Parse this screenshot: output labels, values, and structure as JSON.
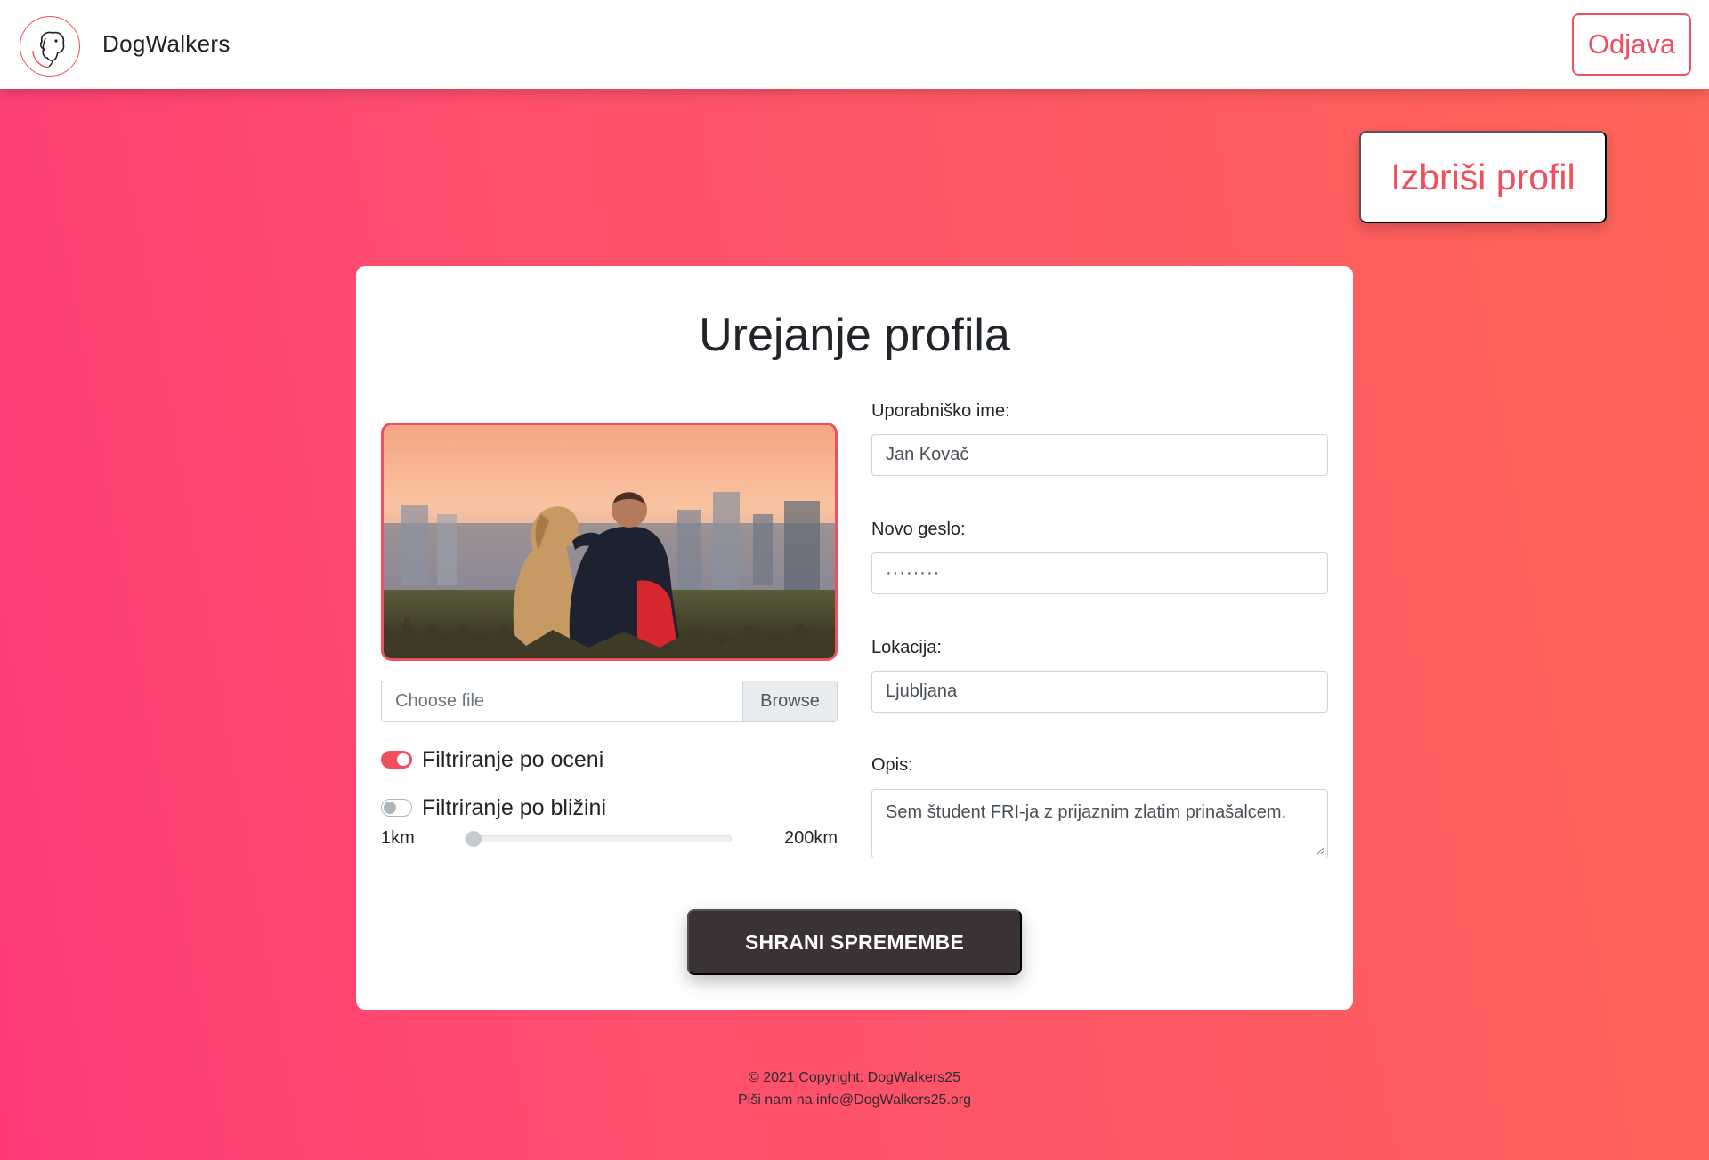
{
  "navbar": {
    "brand": "DogWalkers",
    "logout_label": "Odjava"
  },
  "delete_profile_label": "Izbriši profil",
  "form": {
    "title": "Urejanje profila",
    "file_input": {
      "placeholder": "Choose file",
      "browse_label": "Browse"
    },
    "toggles": [
      {
        "label": "Filtriranje po oceni",
        "on": true
      },
      {
        "label": "Filtriranje po bližini",
        "on": false
      }
    ],
    "distance_range": {
      "min_label": "1km",
      "max_label": "200km",
      "min": 1,
      "max": 200,
      "value": 1
    },
    "username": {
      "label": "Uporabniško ime:",
      "value": "Jan Kovač"
    },
    "password": {
      "label": "Novo geslo:",
      "value": "········"
    },
    "location": {
      "label": "Lokacija:",
      "value": "Ljubljana"
    },
    "description": {
      "label": "Opis:",
      "value": "Sem študent FRI-ja z prijaznim zlatim prinašalcem."
    },
    "save_label": "SHRANI SPREMEMBE"
  },
  "footer": {
    "copyright": "© 2021 Copyright: DogWalkers25",
    "contact": "Piši nam na info@DogWalkers25.org"
  },
  "colors": {
    "accent": "#f0505e",
    "gradient_start": "#fe3a75",
    "gradient_end": "#fe6458",
    "save_button": "#3a3234"
  },
  "icons": {
    "logo": "dog-logo-icon",
    "resize": "resize-grip-icon"
  }
}
